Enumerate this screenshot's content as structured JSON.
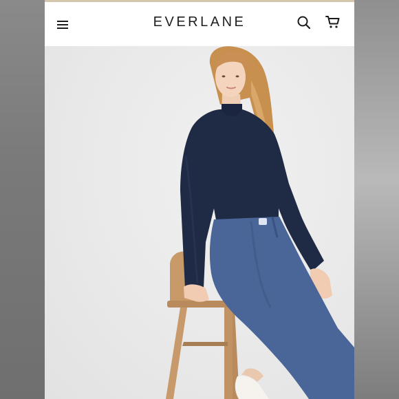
{
  "header": {
    "logo_text": "EVERLANE",
    "menu_icon": "hamburger-menu-icon",
    "search_icon": "search-icon",
    "cart_icon": "shopping-cart-icon"
  },
  "hero": {
    "image": "model-navy-mockneck-blue-wide-leg-pants",
    "colors": {
      "background": "#eaeaea",
      "top": "#1f2a44",
      "pants": "#4a6598",
      "hair": "#c98f55",
      "stool": "#c69868"
    }
  }
}
